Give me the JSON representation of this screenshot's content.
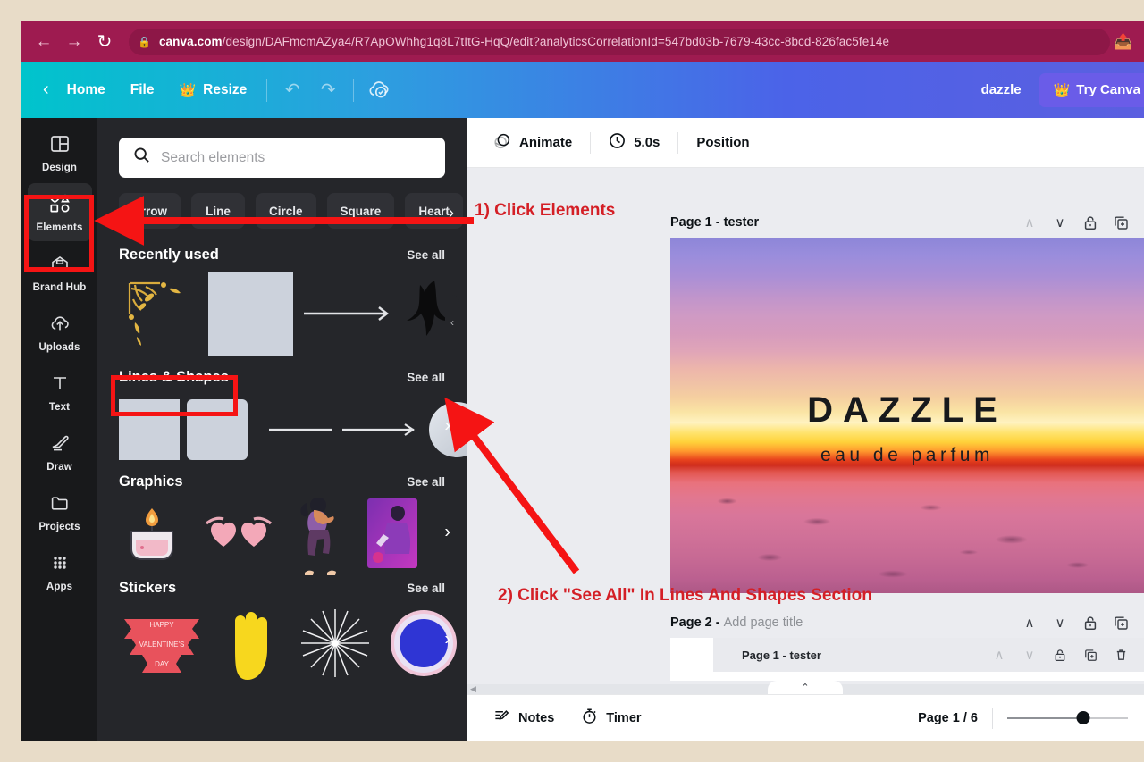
{
  "browser": {
    "back_icon": "back-arrow-icon",
    "forward_icon": "forward-arrow-icon",
    "reload_icon": "reload-icon",
    "lock_icon": "lock-icon",
    "url_domain": "canva.com",
    "url_path": "/design/DAFmcmAZya4/R7ApOWhhg1q8L7tItG-HqQ/edit?analyticsCorrelationId=547bd03b-7679-43cc-8bcd-826fac5fe14e",
    "share_icon": "share-icon"
  },
  "topbar": {
    "back_chevron": "‹",
    "home_label": "Home",
    "file_label": "File",
    "resize_label": "Resize",
    "resize_badge": "👑",
    "undo_icon": "undo-icon",
    "redo_icon": "redo-icon",
    "cloud_saved_icon": "cloud-check-icon",
    "user_name": "dazzle",
    "try_canva_label": "Try Canva",
    "try_canva_badge": "👑",
    "accent_gradient_from": "#00c4cc",
    "accent_gradient_to": "#5b5fe0"
  },
  "rail": {
    "items": [
      {
        "label": "Design",
        "icon": "design-icon",
        "active": false
      },
      {
        "label": "Elements",
        "icon": "elements-icon",
        "active": true
      },
      {
        "label": "Brand Hub",
        "icon": "brand-hub-icon",
        "active": false
      },
      {
        "label": "Uploads",
        "icon": "uploads-icon",
        "active": false
      },
      {
        "label": "Text",
        "icon": "text-icon",
        "active": false
      },
      {
        "label": "Draw",
        "icon": "draw-icon",
        "active": false
      },
      {
        "label": "Projects",
        "icon": "projects-icon",
        "active": false
      },
      {
        "label": "Apps",
        "icon": "apps-icon",
        "active": false
      }
    ]
  },
  "panel": {
    "search_placeholder": "Search elements",
    "search_value": "",
    "search_icon": "search-icon",
    "chips": [
      "Arrow",
      "Line",
      "Circle",
      "Square",
      "Heart"
    ],
    "chips_next_icon": "chevron-right-icon",
    "collapse_icon": "‹",
    "sections": [
      {
        "title": "Recently used",
        "see_all": "See all"
      },
      {
        "title": "Lines & Shapes",
        "see_all": "See all"
      },
      {
        "title": "Graphics",
        "see_all": "See all"
      },
      {
        "title": "Stickers",
        "see_all": "See all"
      }
    ]
  },
  "editor": {
    "toolbar": {
      "animate_label": "Animate",
      "animate_icon": "animate-icon",
      "duration_label": "5.0s",
      "duration_icon": "clock-icon",
      "position_label": "Position"
    },
    "pages": [
      {
        "title_prefix": "Page 1",
        "title_sep": " - ",
        "title": "tester",
        "title_is_placeholder": false
      },
      {
        "title_prefix": "Page 2",
        "title_sep": " - ",
        "title": "Add page title",
        "title_is_placeholder": true
      }
    ],
    "page_tools": {
      "up_icon": "chevron-up-icon",
      "down_icon": "chevron-down-icon",
      "lock_icon": "lock-icon",
      "duplicate_icon": "duplicate-icon",
      "delete_icon": "trash-icon"
    },
    "thumb_row_label": "Page 1 - tester",
    "design": {
      "brand_title": "DAZZLE",
      "brand_subtitle": "eau de parfum"
    }
  },
  "statusbar": {
    "notes_label": "Notes",
    "notes_icon": "notes-icon",
    "timer_label": "Timer",
    "timer_icon": "timer-icon",
    "page_indicator": "Page 1 / 6",
    "zoom_percent": 63,
    "collapse_icon": "⌃"
  },
  "annotations": {
    "color": "#d41f26",
    "step1": "1) Click Elements",
    "step2": "2) Click \"See All\" In Lines And Shapes Section",
    "box_color": "#f51414"
  }
}
